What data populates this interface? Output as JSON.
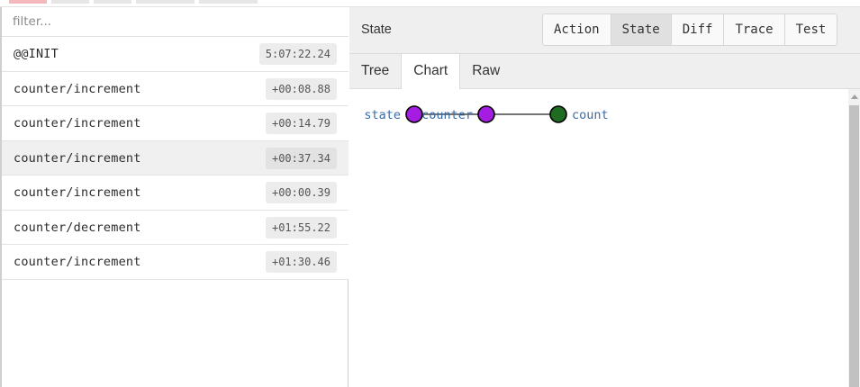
{
  "filter": {
    "placeholder": "filter..."
  },
  "actions": [
    {
      "name": "@@INIT",
      "time": "5:07:22.24",
      "selected": false
    },
    {
      "name": "counter/increment",
      "time": "+00:08.88",
      "selected": false
    },
    {
      "name": "counter/increment",
      "time": "+00:14.79",
      "selected": false
    },
    {
      "name": "counter/increment",
      "time": "+00:37.34",
      "selected": true
    },
    {
      "name": "counter/increment",
      "time": "+00:00.39",
      "selected": false
    },
    {
      "name": "counter/decrement",
      "time": "+01:55.22",
      "selected": false
    },
    {
      "name": "counter/increment",
      "time": "+01:30.46",
      "selected": false
    }
  ],
  "header": {
    "title": "State"
  },
  "mode_tabs": [
    {
      "label": "Action",
      "active": false
    },
    {
      "label": "State",
      "active": true
    },
    {
      "label": "Diff",
      "active": false
    },
    {
      "label": "Trace",
      "active": false
    },
    {
      "label": "Test",
      "active": false
    }
  ],
  "sub_tabs": [
    {
      "label": "Tree",
      "active": false
    },
    {
      "label": "Chart",
      "active": true
    },
    {
      "label": "Raw",
      "active": false
    }
  ],
  "state_chart": {
    "nodes": [
      {
        "label": "state",
        "kind": "branch"
      },
      {
        "label": "counter",
        "kind": "branch"
      },
      {
        "label": "count",
        "kind": "leaf"
      }
    ],
    "colors": {
      "branch_fill": "#a51de0",
      "leaf_fill": "#1f6b22",
      "node_stroke": "#000000",
      "label": "#3a6aa8",
      "link": "#222222"
    }
  },
  "colors": {
    "selected_row": "#f0f0f0",
    "active_tab": "#e0e0e0",
    "header_bg": "#efefef"
  }
}
